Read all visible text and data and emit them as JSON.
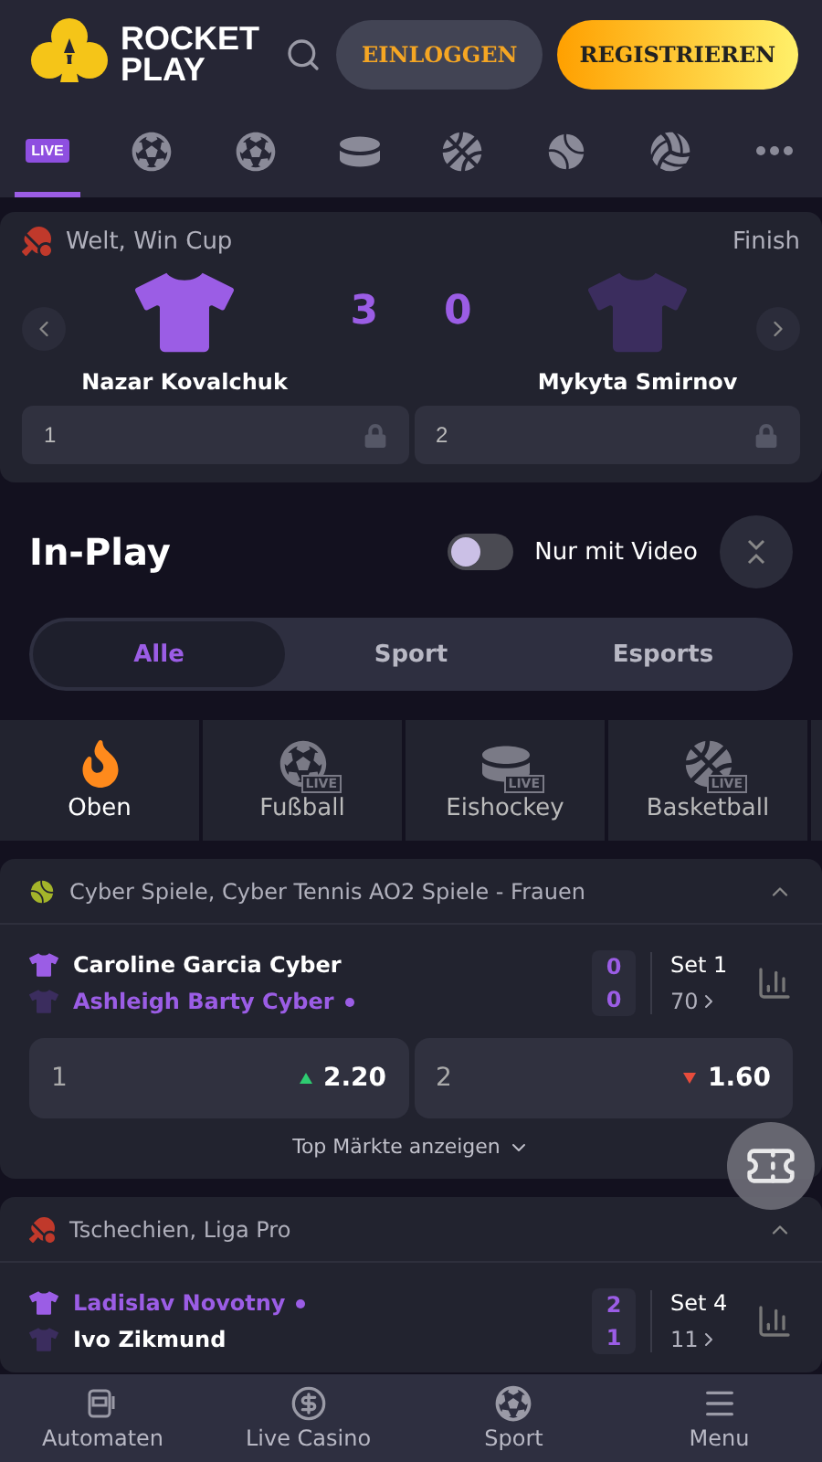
{
  "header": {
    "logo": {
      "line1": "ROCKET",
      "line2": "PLAY"
    },
    "login": "EINLOGGEN",
    "register": "REGISTRIEREN"
  },
  "sport_nav": [
    {
      "kind": "live",
      "badge": "LIVE",
      "selected": true
    },
    {
      "kind": "soccer",
      "selected": false
    },
    {
      "kind": "soccer",
      "selected": false
    },
    {
      "kind": "hockey",
      "selected": false
    },
    {
      "kind": "basketball",
      "selected": false
    },
    {
      "kind": "tennis",
      "selected": false
    },
    {
      "kind": "volleyball",
      "selected": false
    },
    {
      "kind": "more",
      "selected": false
    }
  ],
  "featured_match": {
    "kind": "table-tennis",
    "league": "Welt, Win Cup",
    "status": "Finish",
    "teams": [
      {
        "name": "Nazar Kovalchuk",
        "score": "3",
        "color": "#9b5de5"
      },
      {
        "name": "Mykyta Smirnov",
        "score": "0",
        "color": "#3b2d5e"
      }
    ],
    "odds": [
      {
        "label": "1",
        "locked": true
      },
      {
        "label": "2",
        "locked": true
      }
    ]
  },
  "in_play": {
    "title": "In-Play",
    "video_toggle": {
      "label": "Nur mit Video",
      "on": false
    }
  },
  "filter_tabs": [
    {
      "label": "Alle",
      "selected": true
    },
    {
      "label": "Sport",
      "selected": false
    },
    {
      "label": "Esports",
      "selected": false
    }
  ],
  "categories": [
    {
      "kind": "top",
      "label": "Oben"
    },
    {
      "kind": "soccer",
      "label": "Fußball",
      "badge": "LIVE"
    },
    {
      "kind": "hockey",
      "label": "Eishockey",
      "badge": "LIVE"
    },
    {
      "kind": "basketball",
      "label": "Basketball",
      "badge": "LIVE"
    }
  ],
  "events": [
    {
      "kind": "tennis",
      "league": "Cyber Spiele, Cyber Tennis AO2 Spiele - Frauen",
      "expanded": true,
      "players": [
        {
          "name": "Caroline Garcia Cyber",
          "serving": false,
          "score": "0",
          "color": "#9b5de5"
        },
        {
          "name": "Ashleigh Barty Cyber",
          "serving": true,
          "score": "0",
          "color": "#3b2d5e"
        }
      ],
      "period": "Set 1",
      "markets": "70",
      "odds": [
        {
          "label": "1",
          "value": "2.20",
          "kind": "up"
        },
        {
          "label": "2",
          "value": "1.60",
          "kind": "down"
        }
      ],
      "more": "Top Märkte anzeigen"
    },
    {
      "kind": "table-tennis",
      "league": "Tschechien, Liga Pro",
      "expanded": true,
      "players": [
        {
          "name": "Ladislav Novotny",
          "serving": true,
          "score": "2",
          "color": "#9b5de5"
        },
        {
          "name": "Ivo Zikmund",
          "serving": false,
          "score": "1",
          "color": "#3b2d5e"
        }
      ],
      "period": "Set 4",
      "markets": "11"
    }
  ],
  "bottom_nav": [
    {
      "kind": "slots",
      "label": "Automaten"
    },
    {
      "kind": "live-casino",
      "label": "Live Casino"
    },
    {
      "kind": "sport",
      "label": "Sport"
    },
    {
      "kind": "menu",
      "label": "Menu"
    }
  ]
}
